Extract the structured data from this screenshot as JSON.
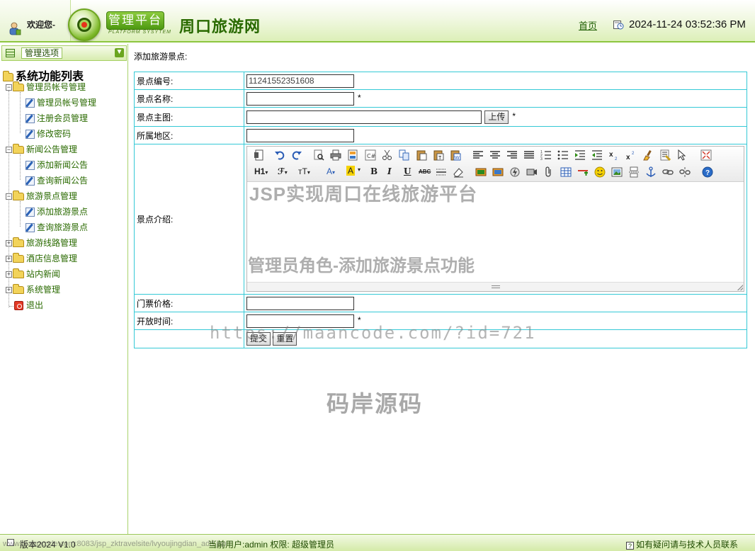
{
  "header": {
    "welcome": "欢迎您-",
    "platform_badge": "管理平台",
    "platform_sub": "PLATFORM SYSYTEM",
    "site_title": "周口旅游网",
    "home_link": "首页",
    "datetime": "2024-11-24 03:52:36 PM"
  },
  "sidebar": {
    "menu_title": "管理选项",
    "root": "系统功能列表",
    "groups": [
      {
        "label": "管理员帐号管理",
        "items": [
          "管理员帐号管理",
          "注册会员管理",
          "修改密码"
        ]
      },
      {
        "label": "新闻公告管理",
        "items": [
          "添加新闻公告",
          "查询新闻公告"
        ]
      },
      {
        "label": "旅游景点管理",
        "items": [
          "添加旅游景点",
          "查询旅游景点"
        ]
      },
      {
        "label": "旅游线路管理",
        "items": []
      },
      {
        "label": "酒店信息管理",
        "items": []
      },
      {
        "label": "站内新闻",
        "items": []
      },
      {
        "label": "系统管理",
        "items": []
      }
    ],
    "exit": "退出"
  },
  "main": {
    "heading": "添加旅游景点:",
    "form": {
      "id_label": "景点编号:",
      "id_value": "11241552351608",
      "name_label": "景点名称:",
      "name_value": "",
      "image_label": "景点主图:",
      "image_value": "",
      "upload_button": "上传",
      "region_label": "所属地区:",
      "region_value": "",
      "intro_label": "景点介绍:",
      "price_label": "门票价格:",
      "price_value": "",
      "hours_label": "开放时间:",
      "hours_value": "",
      "required_mark": "*",
      "submit_button": "提交",
      "reset_button": "重置"
    }
  },
  "editor": {
    "row2_text": {
      "heading": "H1",
      "font": "ℱ",
      "size": "тT",
      "font_color": "A",
      "bg_color": "A",
      "bold": "B",
      "italic": "I",
      "underline": "U",
      "strike": "ABC"
    }
  },
  "watermarks": {
    "line1": "JSP实现周口在线旅游平台",
    "line2": "管理员角色-添加旅游景点功能",
    "line3": "https://maancode.com/?id=721",
    "line4": "码岸源码"
  },
  "footer": {
    "version": "版本2024 V1.0",
    "status_url": "www.maancode.com:8083/jsp_zktravelsite/lvyoujingdian_add.jsp",
    "current_user": "当前用户:admin 权限:  超级管理员",
    "help_icon": "?",
    "help_text": "如有疑问请与技术人员联系"
  },
  "colors": {
    "theme_green": "#8dc63f",
    "table_border": "#35c9d6",
    "link_green": "#2a6a00"
  }
}
